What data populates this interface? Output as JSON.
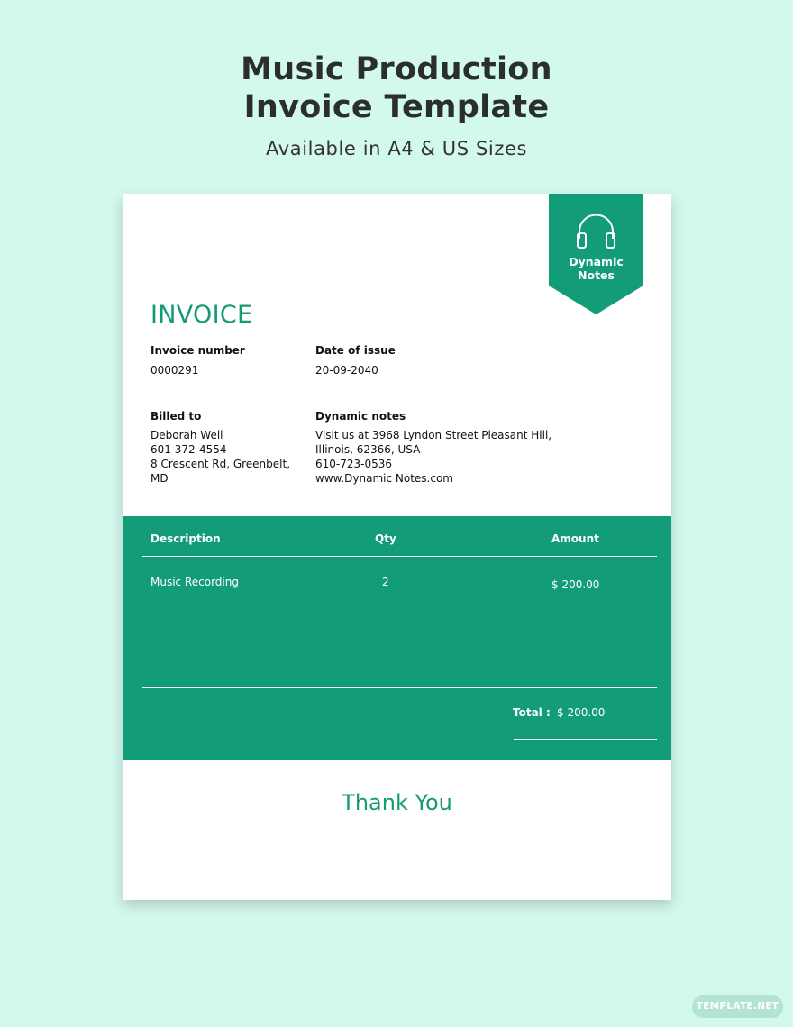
{
  "header": {
    "title_line1": "Music Production",
    "title_line2": "Invoice Template",
    "subtitle": "Available in A4 & US Sizes"
  },
  "logo": {
    "icon": "headphones-icon",
    "line1": "Dynamic",
    "line2": "Notes"
  },
  "invoice": {
    "title": "INVOICE",
    "number_label": "Invoice number",
    "number_value": "0000291",
    "date_label": "Date of issue",
    "date_value": "20-09-2040"
  },
  "billed": {
    "label": "Billed to",
    "name": "Deborah Well",
    "phone": "601 372-4554",
    "address1": "8 Crescent Rd, Greenbelt,",
    "address2": "MD"
  },
  "company": {
    "label": "Dynamic notes",
    "line1": "Visit us at 3968 Lyndon Street Pleasant Hill,",
    "line2": "Illinois, 62366, USA",
    "phone": "610-723-0536",
    "web": "www.Dynamic Notes.com"
  },
  "table": {
    "headers": [
      "Description",
      "Qty",
      "Amount"
    ],
    "rows": [
      {
        "description": "Music Recording",
        "qty": "2",
        "amount": "$ 200.00"
      }
    ],
    "total_label": "Total :",
    "total_value": "$ 200.00"
  },
  "footer": {
    "thanks": "Thank You"
  },
  "watermark": "TEMPLATE.NET",
  "colors": {
    "background": "#d3f8ed",
    "accent": "#129c77",
    "sheet": "#ffffff"
  }
}
